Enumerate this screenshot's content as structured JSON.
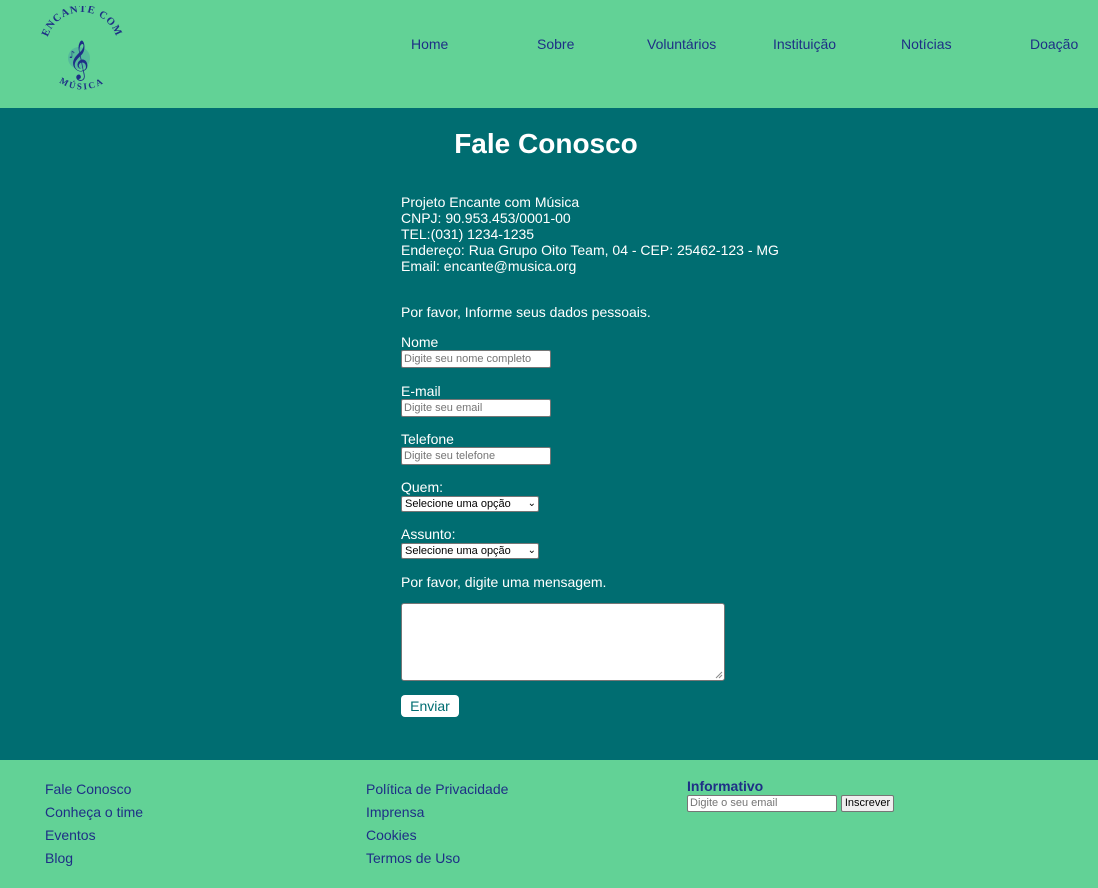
{
  "header": {
    "logo": {
      "top_text": "ENCANTE COM",
      "bottom_text": "MÚSICA",
      "icon": "treble-clef-icon"
    },
    "nav": [
      "Home",
      "Sobre",
      "Voluntários",
      "Instituição",
      "Notícias",
      "Doação"
    ]
  },
  "main": {
    "title": "Fale Conosco",
    "info": [
      "Projeto Encante com Música",
      "CNPJ: 90.953.453/0001-00",
      "TEL:(031) 1234-1235",
      "Endereço: Rua Grupo Oito Team, 04 - CEP: 25462-123 - MG",
      "Email: encante@musica.org"
    ],
    "form": {
      "intro": "Por favor, Informe seus dados pessoais.",
      "name_label": "Nome",
      "name_placeholder": "Digite seu nome completo",
      "email_label": "E-mail",
      "email_placeholder": "Digite seu email",
      "phone_label": "Telefone",
      "phone_placeholder": "Digite seu telefone",
      "who_label": "Quem:",
      "who_selected": "Selecione uma opção",
      "subject_label": "Assunto:",
      "subject_selected": "Selecione uma opção",
      "message_label": "Por favor, digite uma mensagem.",
      "message_value": "",
      "submit_label": "Enviar"
    }
  },
  "footer": {
    "col1": [
      "Fale Conosco",
      "Conheça o time",
      "Eventos",
      "Blog"
    ],
    "col2": [
      "Política de Privacidade",
      "Imprensa",
      "Cookies",
      "Termos de Uso"
    ],
    "newsletter": {
      "title": "Informativo",
      "placeholder": "Digite o seu email",
      "button": "Inscrever"
    }
  },
  "colors": {
    "header_bg": "#62D296",
    "main_bg": "#006D71",
    "link": "#1E2F86"
  }
}
